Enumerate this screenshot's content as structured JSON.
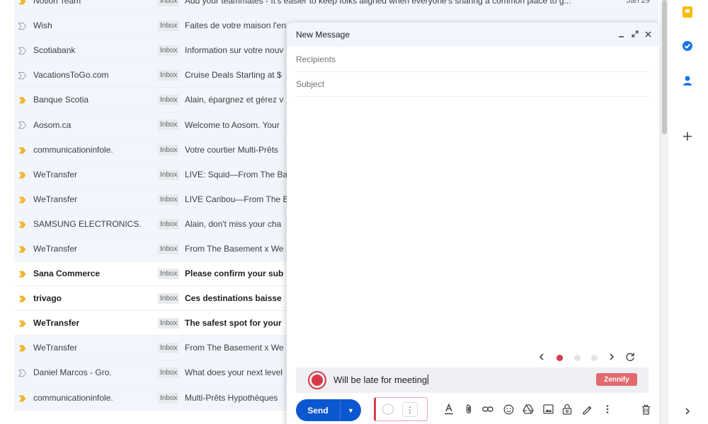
{
  "mail_list": [
    {
      "sender": "Notion Team",
      "label": "Inbox",
      "subject": "Add your teammates - It's easier to keep folks aligned when everyone's sharing a common place to g...",
      "date": "Jan 29",
      "important": true,
      "unread": false
    },
    {
      "sender": "Wish",
      "label": "Inbox",
      "subject": "Faites de votre maison l'en",
      "date": "",
      "important": false,
      "unread": false
    },
    {
      "sender": "Scotiabank",
      "label": "Inbox",
      "subject": "Information sur votre nouv",
      "date": "",
      "important": false,
      "unread": false
    },
    {
      "sender": "VacationsToGo.com",
      "label": "Inbox",
      "subject": "Cruise Deals Starting at $",
      "date": "",
      "important": false,
      "unread": false
    },
    {
      "sender": "Banque Scotia",
      "label": "Inbox",
      "subject": "Alain, épargnez et gérez v",
      "date": "",
      "important": true,
      "unread": false
    },
    {
      "sender": "Aosom.ca",
      "label": "Inbox",
      "subject": "Welcome to Aosom. Your ",
      "date": "",
      "important": false,
      "unread": false
    },
    {
      "sender": "communicationinfole.",
      "label": "Inbox",
      "subject": "Votre courtier Multi-Prêts",
      "date": "",
      "important": true,
      "unread": false
    },
    {
      "sender": "WeTransfer",
      "label": "Inbox",
      "subject": "LIVE: Squid—From The Ba",
      "date": "",
      "important": true,
      "unread": false
    },
    {
      "sender": "WeTransfer",
      "label": "Inbox",
      "subject": "LIVE Caribou—From The B",
      "date": "",
      "important": true,
      "unread": false
    },
    {
      "sender": "SAMSUNG ELECTRONICS.",
      "label": "Inbox",
      "subject": "Alain, don't miss your cha",
      "date": "",
      "important": true,
      "unread": false
    },
    {
      "sender": "WeTransfer",
      "label": "Inbox",
      "subject": "From The Basement x We",
      "date": "",
      "important": true,
      "unread": false
    },
    {
      "sender": "Sana Commerce",
      "label": "Inbox",
      "subject": "Please confirm your sub",
      "date": "",
      "important": true,
      "unread": true
    },
    {
      "sender": "trivago",
      "label": "Inbox",
      "subject": "Ces destinations baisse",
      "date": "",
      "important": true,
      "unread": true
    },
    {
      "sender": "WeTransfer",
      "label": "Inbox",
      "subject": "The safest spot for your",
      "date": "",
      "important": true,
      "unread": true
    },
    {
      "sender": "WeTransfer",
      "label": "Inbox",
      "subject": "From The Basement x We",
      "date": "",
      "important": true,
      "unread": false
    },
    {
      "sender": "Daniel Marcos - Gro.",
      "label": "Inbox",
      "subject": "What does your next level",
      "date": "",
      "important": false,
      "unread": false
    },
    {
      "sender": "communicationinfole.",
      "label": "Inbox",
      "subject": "Multi-Prêts Hypothèques",
      "date": "",
      "important": true,
      "unread": false
    }
  ],
  "compose": {
    "title": "New Message",
    "recipients_placeholder": "Recipients",
    "subject_placeholder": "Subject",
    "suggestion_text": "Will be late for meeting",
    "zennify_label": "Zennify",
    "send_label": "Send"
  },
  "colors": {
    "accent": "#0b57d0",
    "zennify": "#e26a6f",
    "brand_red": "#d93a4a",
    "important": "#f2b632"
  },
  "icons": [
    "keep-icon",
    "tasks-icon",
    "contacts-icon",
    "add-icon",
    "expand-panel-icon"
  ]
}
